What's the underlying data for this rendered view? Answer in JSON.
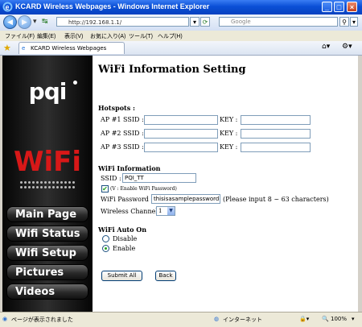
{
  "window": {
    "title": "KCARD Wireless Webpages - Windows Internet Explorer"
  },
  "browser": {
    "url": "http://192.168.1.1/",
    "search_placeholder": "Google",
    "menu": [
      "ファイル(F)",
      "編集(E)",
      "表示(V)",
      "お気に入り(A)",
      "ツール(T)",
      "ヘルプ(H)"
    ],
    "tab_label": "KCARD Wireless Webpages"
  },
  "sidebar": {
    "logo": "pqi",
    "brand": "WiFi",
    "nav": [
      "Main Page",
      "Wifi Status",
      "Wifi Setup",
      "Pictures",
      "Videos"
    ]
  },
  "page": {
    "title": "WiFi Information Setting",
    "hotspots": {
      "heading": "Hotspots :",
      "rows": [
        {
          "label": "AP #1 SSID :",
          "key_label": "KEY :",
          "ssid": "",
          "key": ""
        },
        {
          "label": "AP #2 SSID :",
          "key_label": "KEY :",
          "ssid": "",
          "key": ""
        },
        {
          "label": "AP #3 SSID :",
          "key_label": "KEY :",
          "ssid": "",
          "key": ""
        }
      ]
    },
    "wifi_info": {
      "heading": "WiFi Information",
      "ssid_label": "SSID :",
      "ssid_value": "PQI_TT",
      "enable_pw_label": "(V : Enable WiFi Password)",
      "enable_pw_checked": true,
      "password_label": "WiFi Password :",
      "password_value": "thisisasamplepassword",
      "password_hint": "(Please input 8 ~ 63 characters)",
      "channel_label": "Wireless Channel :",
      "channel_value": "1"
    },
    "auto_on": {
      "heading": "WiFi Auto On",
      "options": [
        "Disable",
        "Enable"
      ],
      "selected": "Enable"
    },
    "buttons": {
      "submit": "Submit All",
      "back": "Back"
    }
  },
  "statusbar": {
    "left": "ページが表示されました",
    "zone": "インターネット",
    "zoom": "100%"
  }
}
